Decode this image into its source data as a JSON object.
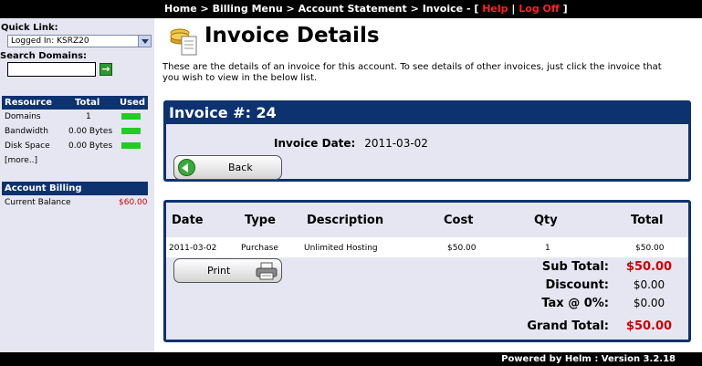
{
  "topbar": {
    "home": "Home",
    "sep": ">",
    "billing_menu": "Billing Menu",
    "account_statement": "Account Statement",
    "invoice": "Invoice",
    "dash_open": "- [",
    "help": "Help",
    "pipe": "|",
    "logoff": "Log Off",
    "close": "]"
  },
  "sidebar": {
    "quick_link_label": "Quick Link:",
    "quick_link_value": "Logged In: KSRZ20",
    "search_label": "Search Domains:",
    "search_value": "",
    "go_icon": "arrow-right-icon",
    "resource_header": {
      "resource": "Resource",
      "total": "Total",
      "used": "Used"
    },
    "resources": [
      {
        "name": "Domains",
        "total": "1",
        "used_color": "#22cc22"
      },
      {
        "name": "Bandwidth",
        "total": "0.00 Bytes",
        "used_color": "#22cc22"
      },
      {
        "name": "Disk Space",
        "total": "0.00 Bytes",
        "used_color": "#22cc22"
      }
    ],
    "more_link": "[more..]",
    "billing_header": "Account Billing",
    "balance_label": "Current Balance",
    "balance_value": "$60.00"
  },
  "main": {
    "title": "Invoice Details",
    "intro": "These are the details of an invoice for this account. To see details of other invoices, just click the invoice that you wish to view in the below list.",
    "invoice_header": "Invoice #: 24",
    "invoice_date_label": "Invoice Date:",
    "invoice_date_value": "2011-03-02",
    "back_button": "Back",
    "table": {
      "columns": [
        "Date",
        "Type",
        "Description",
        "Cost",
        "Qty",
        "Total"
      ],
      "rows": [
        {
          "date": "2011-03-02",
          "type": "Purchase",
          "description": "Unlimited Hosting",
          "cost": "$50.00",
          "qty": "1",
          "total": "$50.00"
        }
      ]
    },
    "print_button": "Print",
    "subtotal_label": "Sub Total:",
    "subtotal_value": "$50.00",
    "discount_label": "Discount:",
    "discount_value": "$0.00",
    "tax_label": "Tax @ 0%:",
    "tax_value": "$0.00",
    "grand_total_label": "Grand Total:",
    "grand_total_value": "$50.00"
  },
  "footer": {
    "text": "Powered by Helm  :  Version 3.2.18"
  },
  "colors": {
    "navy": "#0d3270",
    "panel_bg": "#e6e6f2",
    "accent_red": "#cc0000",
    "used_bar": "#22cc22"
  }
}
